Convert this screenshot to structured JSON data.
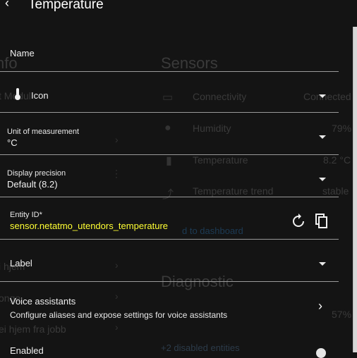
{
  "background": {
    "info_heading": "nfo",
    "sensors_heading": "Sensors",
    "diagnostic_heading": "Diagnostic",
    "rows": [
      {
        "label": "Connectivity",
        "value": "Connected"
      },
      {
        "label": "Humidity",
        "value": "79%"
      },
      {
        "label": "Temperature",
        "value": "8.2 °C"
      },
      {
        "label": "Temperature trend",
        "value": "stable"
      }
    ],
    "fragments": {
      "left_info": "t Modul",
      "left_hjem": "i hjem",
      "left_onge": "onge",
      "left_jobb": "ei hjem fra jobb",
      "add_dashboard": "d to dashboard",
      "disabled_entities": "+2 disabled entities",
      "battery": "57%"
    }
  },
  "dialog": {
    "title": "Temperature",
    "fields": {
      "name": {
        "label": "Name"
      },
      "icon": {
        "label": "Icon"
      },
      "unit": {
        "label": "Unit of measurement",
        "value": "°C"
      },
      "precision": {
        "label": "Display precision",
        "value": "Default (8.2)"
      },
      "entity_id": {
        "label": "Entity ID*",
        "value": "sensor.netatmo_utendors_temperature"
      },
      "label": {
        "label": "Label"
      },
      "voice": {
        "title": "Voice assistants",
        "subtitle": "Configure aliases and expose settings for voice assistants"
      },
      "enabled": {
        "label": "Enabled"
      }
    }
  },
  "icons": [
    "back-arrow-icon",
    "thermometer-icon",
    "caret-down-icon",
    "refresh-icon",
    "copy-icon",
    "chevron-right-icon"
  ],
  "colors": {
    "accent_text": "#ffff33",
    "background": "#141414"
  }
}
